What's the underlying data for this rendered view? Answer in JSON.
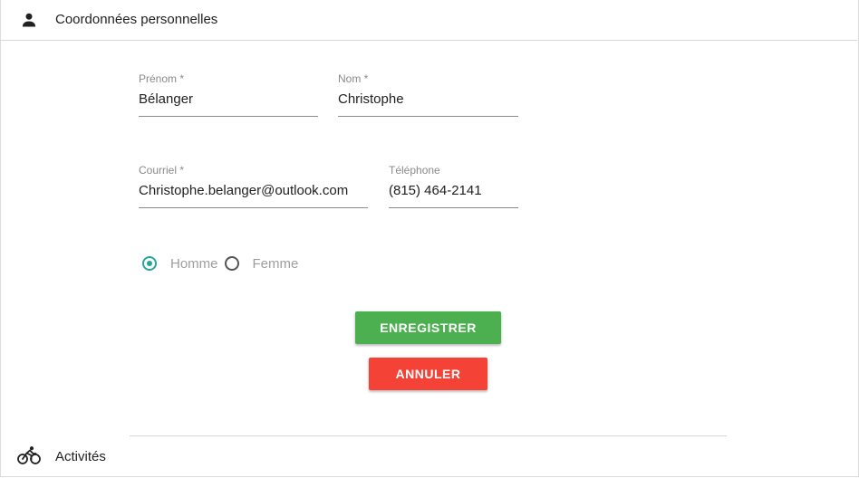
{
  "header": {
    "icon": "person-icon",
    "title": "Coordonnées personnelles"
  },
  "form": {
    "prenom": {
      "label": "Prénom *",
      "value": "Bélanger"
    },
    "nom": {
      "label": "Nom *",
      "value": "Christophe"
    },
    "courriel": {
      "label": "Courriel *",
      "value": "Christophe.belanger@outlook.com"
    },
    "telephone": {
      "label": "Téléphone",
      "value": "(815) 464-2141"
    },
    "gender": {
      "options": [
        {
          "label": "Homme",
          "checked": true
        },
        {
          "label": "Femme",
          "checked": false
        }
      ]
    },
    "save_label": "ENREGISTRER",
    "cancel_label": "ANNULER"
  },
  "footer": {
    "icon": "bicycle-icon",
    "title": "Activités"
  },
  "colors": {
    "accent": "#26a69a",
    "save": "#4caf50",
    "cancel": "#f44336"
  }
}
